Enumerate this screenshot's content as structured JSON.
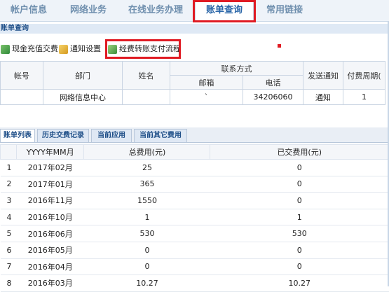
{
  "topnav": {
    "tabs": [
      {
        "label": "帐户信息"
      },
      {
        "label": "网络业务"
      },
      {
        "label": "在线业务办理"
      },
      {
        "label": "账单查询"
      },
      {
        "label": "常用链接"
      }
    ]
  },
  "section_title": "账单查询",
  "toolbar": {
    "recharge": "现金充值交费",
    "notify": "通知设置",
    "transfer": "经费转账支付流程"
  },
  "info_table": {
    "headers": {
      "account": "帐号",
      "dept": "部门",
      "name": "姓名",
      "contact": "联系方式",
      "email": "邮箱",
      "phone": "电话",
      "send": "发送通知",
      "cycle": "付费周期("
    },
    "row": {
      "account": "",
      "dept": "网络信息中心",
      "name": "",
      "email": "`",
      "phone": "34206060",
      "send": "通知",
      "cycle": "1"
    }
  },
  "tabs2": [
    "账单列表",
    "历史交费记录",
    "当前应用",
    "当前其它费用"
  ],
  "bill_table": {
    "headers": [
      "",
      "YYYY年MM月",
      "总费用(元)",
      "已交费用(元)"
    ],
    "rows": [
      {
        "idx": "1",
        "month": "2017年02月",
        "total": "25",
        "paid": "0"
      },
      {
        "idx": "2",
        "month": "2017年01月",
        "total": "365",
        "paid": "0"
      },
      {
        "idx": "3",
        "month": "2016年11月",
        "total": "1550",
        "paid": "0"
      },
      {
        "idx": "4",
        "month": "2016年10月",
        "total": "1",
        "paid": "1"
      },
      {
        "idx": "5",
        "month": "2016年06月",
        "total": "530",
        "paid": "530"
      },
      {
        "idx": "6",
        "month": "2016年05月",
        "total": "0",
        "paid": "0"
      },
      {
        "idx": "7",
        "month": "2016年04月",
        "total": "0",
        "paid": "0"
      },
      {
        "idx": "8",
        "month": "2016年03月",
        "total": "10.27",
        "paid": "10.27"
      }
    ]
  },
  "colors": {
    "highlight": "#e01b23",
    "nav_text": "#6f8fae",
    "title_blue": "#1f4f88"
  }
}
